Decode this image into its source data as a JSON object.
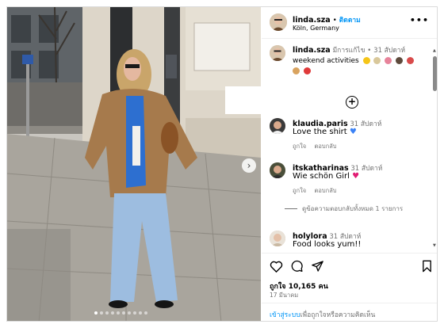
{
  "post": {
    "username": "linda.sza",
    "follow_sep": "•",
    "follow_label": "ติดตาม",
    "location": "Köln, Germany",
    "more_label": "•••"
  },
  "caption": {
    "username": "linda.sza",
    "edited_label": "มีการแก้ไข",
    "time_sep": "•",
    "time": "31 สัปดาห์",
    "text": "weekend activities",
    "emojis": [
      "star",
      "sparkle",
      "donut",
      "bowling",
      "bicycle",
      "bread",
      "strawberry"
    ]
  },
  "load_more_icon": "plus-circle-icon",
  "comments": [
    {
      "username": "klaudia.paris",
      "time": "31 สัปดาห์",
      "text": "Love the shirt",
      "emoji": "blue-heart",
      "emoji_color": "#3b82f6",
      "like_label": "ถูกใจ",
      "reply_label": "ตอบกลับ"
    },
    {
      "username": "itskatharinas",
      "time": "31 สัปดาห์",
      "text": "Wie schön Girl",
      "emoji": "pink-heart",
      "emoji_color": "#e11d74",
      "like_label": "ถูกใจ",
      "reply_label": "ตอบกลับ"
    },
    {
      "username": "holylora",
      "time": "31 สัปดาห์",
      "text": "Food looks yum!!"
    }
  ],
  "view_replies": "ดูข้อความตอบกลับทั้งหมด 1 รายการ",
  "likes_count": "ถูกใจ 10,165 คน",
  "post_date": "17 มีนาคม",
  "add_comment": {
    "login_link": "เข้าสู่ระบบ",
    "rest": "เพื่อถูกใจหรือความคิดเห็น"
  },
  "carousel": {
    "slides": 10,
    "active_index": 0,
    "next_icon": "chevron-right-icon"
  },
  "colors": {
    "accent": "#0095f6",
    "muted": "#737373",
    "border": "#dbdbdb"
  }
}
